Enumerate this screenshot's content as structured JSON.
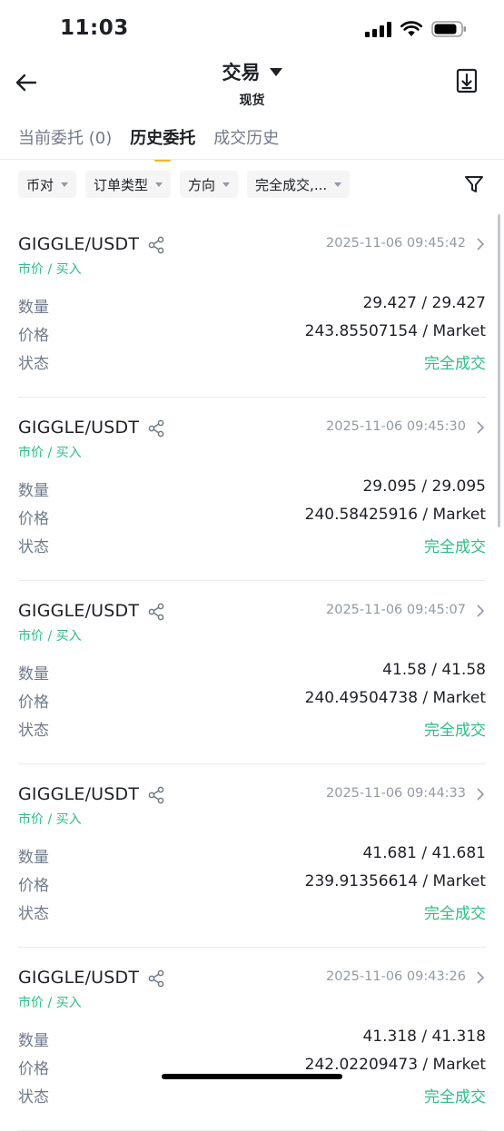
{
  "status_bar": {
    "time": "11:03"
  },
  "header": {
    "title": "交易",
    "subtitle": "现货"
  },
  "tabs": [
    {
      "label": "当前委托 (0)",
      "active": false
    },
    {
      "label": "历史委托",
      "active": true
    },
    {
      "label": "成交历史",
      "active": false
    }
  ],
  "filters": [
    {
      "label": "币对"
    },
    {
      "label": "订单类型"
    },
    {
      "label": "方向"
    },
    {
      "label": "完全成交,..."
    }
  ],
  "labels": {
    "quantity": "数量",
    "price": "价格",
    "status": "状态"
  },
  "orders": [
    {
      "pair": "GIGGLE/USDT",
      "type": "市价 / 买入",
      "time": "2025-11-06 09:45:42",
      "quantity": "29.427 / 29.427",
      "price": "243.85507154 / Market",
      "status": "完全成交"
    },
    {
      "pair": "GIGGLE/USDT",
      "type": "市价 / 买入",
      "time": "2025-11-06 09:45:30",
      "quantity": "29.095 / 29.095",
      "price": "240.58425916 / Market",
      "status": "完全成交"
    },
    {
      "pair": "GIGGLE/USDT",
      "type": "市价 / 买入",
      "time": "2025-11-06 09:45:07",
      "quantity": "41.58 / 41.58",
      "price": "240.49504738 / Market",
      "status": "完全成交"
    },
    {
      "pair": "GIGGLE/USDT",
      "type": "市价 / 买入",
      "time": "2025-11-06 09:44:33",
      "quantity": "41.681 / 41.681",
      "price": "239.91356614 / Market",
      "status": "完全成交"
    },
    {
      "pair": "GIGGLE/USDT",
      "type": "市价 / 买入",
      "time": "2025-11-06 09:43:26",
      "quantity": "41.318 / 41.318",
      "price": "242.02209473 / Market",
      "status": "完全成交"
    }
  ],
  "colors": {
    "accent": "#f0b90b",
    "green": "#2ebd85",
    "muted": "#707a8a",
    "text": "#1e2026"
  },
  "icons": [
    "back-arrow-icon",
    "caret-down-icon",
    "download-icon",
    "filter-icon",
    "share-icon",
    "chevron-right-icon",
    "signal-icon",
    "wifi-icon",
    "battery-icon"
  ]
}
